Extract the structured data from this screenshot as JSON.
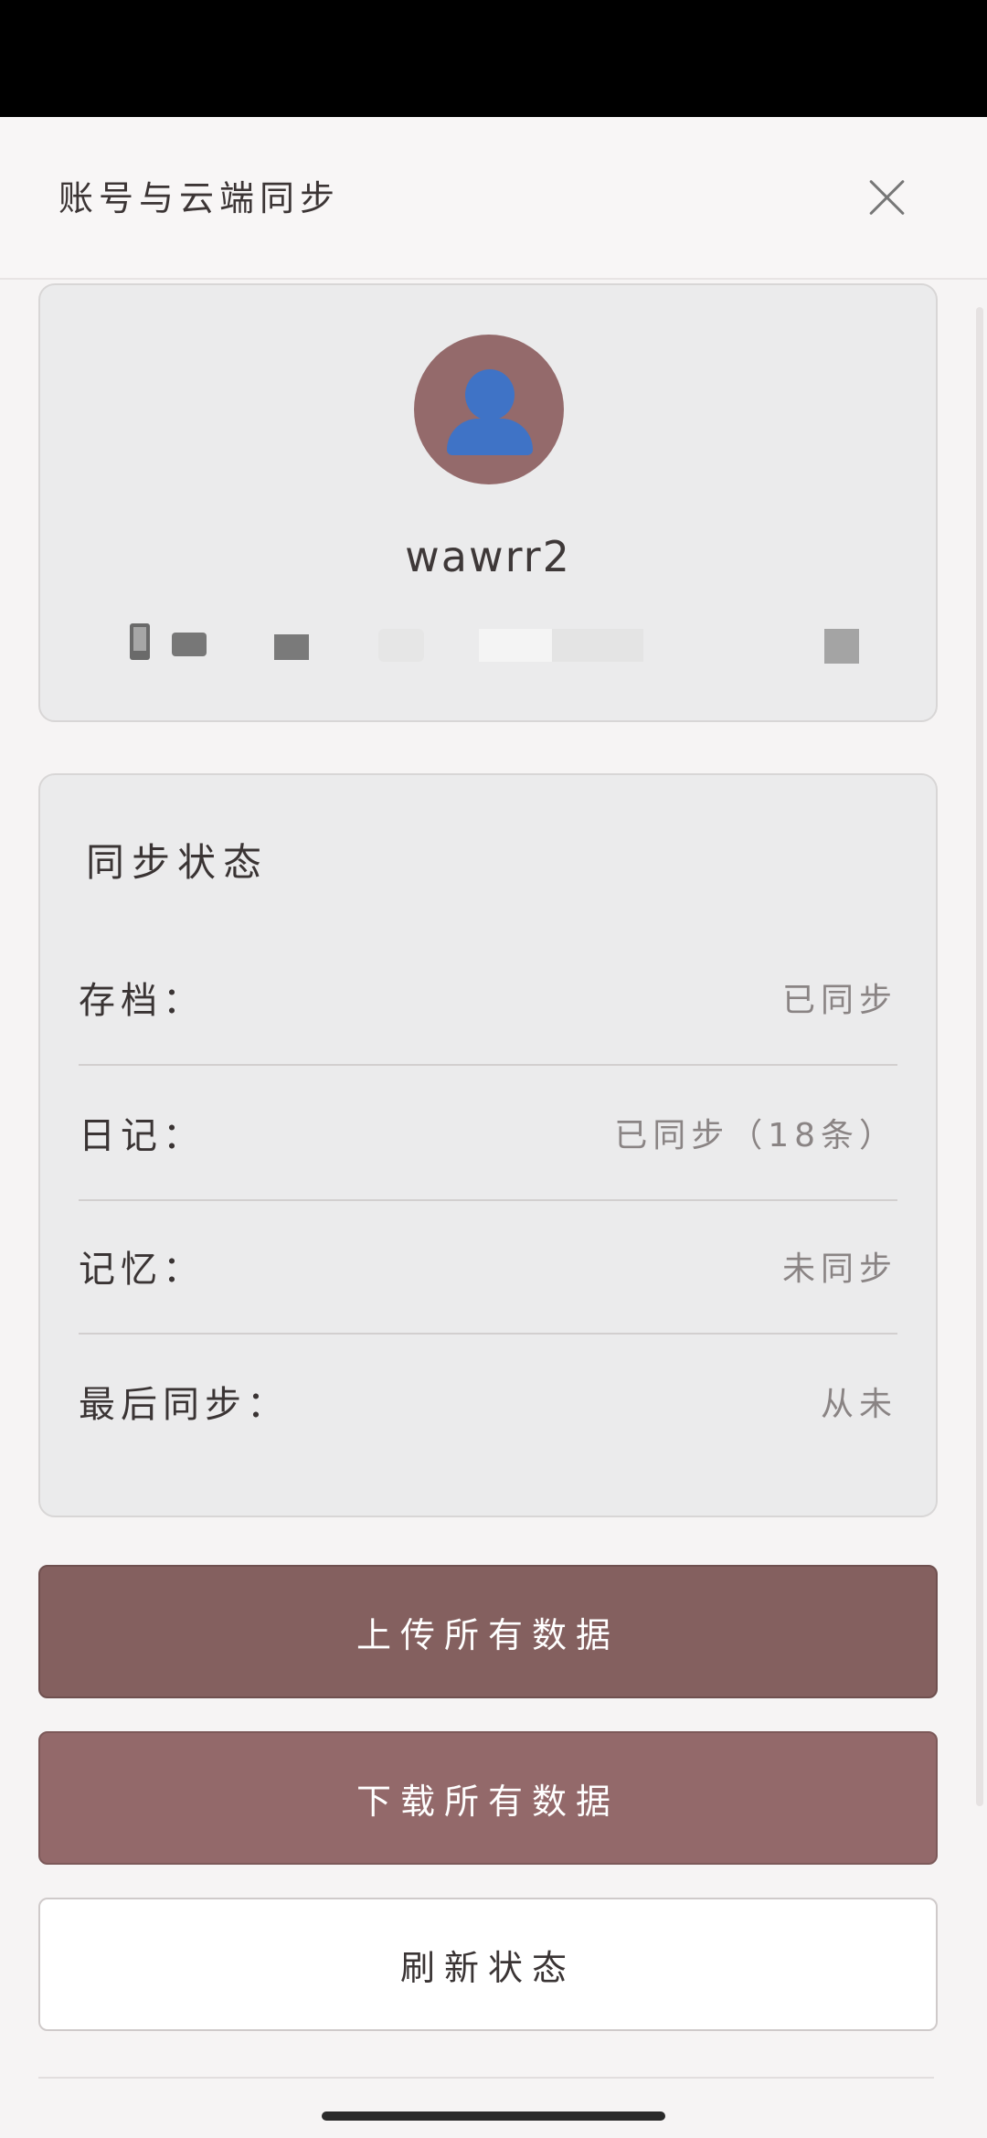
{
  "header": {
    "title": "账号与云端同步"
  },
  "profile": {
    "username": "wawrr2",
    "avatar_icon": "user-silhouette-icon"
  },
  "sync_status": {
    "title": "同步状态",
    "rows": [
      {
        "label": "存档：",
        "value": "已同步"
      },
      {
        "label": "日记：",
        "value": "已同步（18条）"
      },
      {
        "label": "记忆：",
        "value": "未同步"
      },
      {
        "label": "最后同步：",
        "value": "从未"
      }
    ]
  },
  "actions": {
    "upload_label": "上传所有数据",
    "download_label": "下载所有数据",
    "refresh_label": "刷新状态"
  },
  "colors": {
    "upload_button": "#84605f",
    "download_button": "#93696a",
    "avatar_bg": "#946a6b",
    "avatar_figure": "#3f73c6"
  }
}
